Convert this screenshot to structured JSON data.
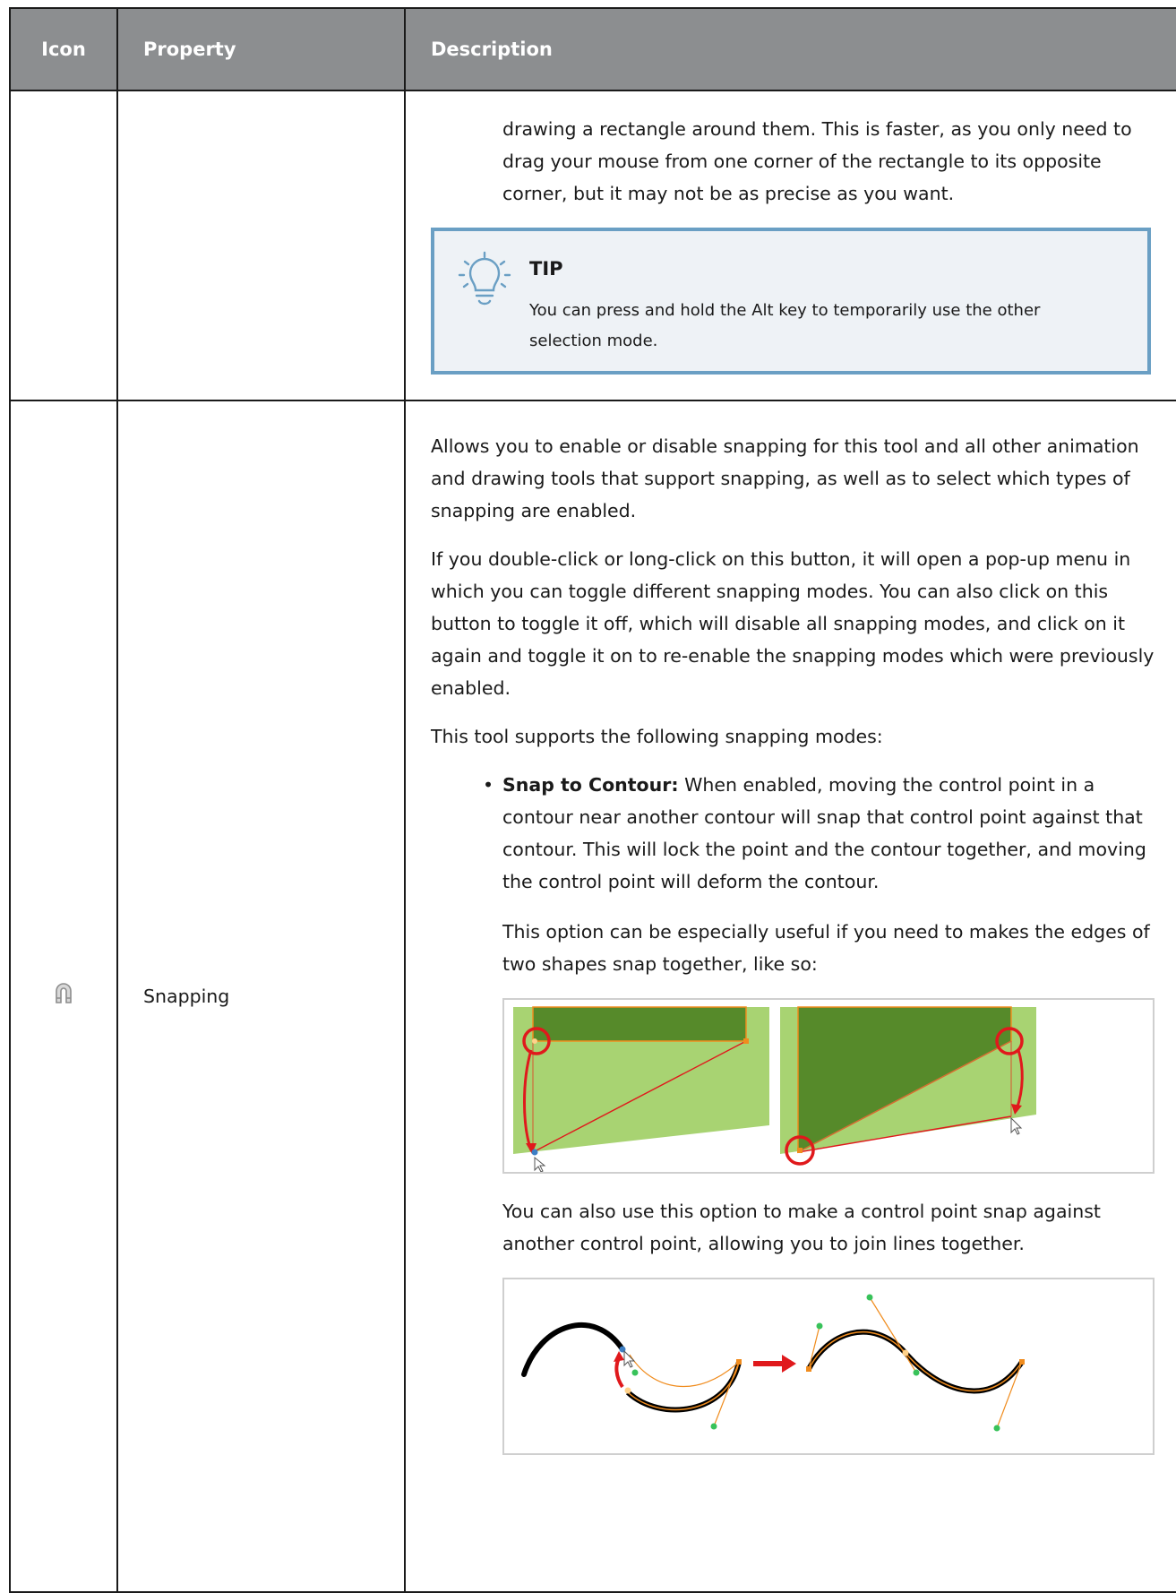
{
  "table": {
    "headers": {
      "icon": "Icon",
      "property": "Property",
      "description": "Description"
    },
    "continued_row": {
      "description_text": "drawing a rectangle around them. This is faster, as you only need to drag your mouse from one corner of the rectangle to its opposite corner, but it may not be as precise as you want.",
      "tip": {
        "icon": "lightbulb-icon",
        "title": "TIP",
        "text": "You can press and hold the Alt key to temporarily use the other selection mode."
      }
    },
    "snapping_row": {
      "icon": "magnet-icon",
      "property": "Snapping",
      "paragraphs": [
        "Allows you to enable or disable snapping for this tool and all other animation and drawing tools that support snapping, as well as to select which types of snapping are enabled.",
        "If you double-click or long-click on this button, it will open a pop-up menu in which you can toggle different snapping modes. You can also click on this button to toggle it off, which will disable all snapping modes, and click on it again and toggle it on to re-enable the snapping modes which were previously enabled.",
        "This tool supports the following snapping modes:"
      ],
      "modes": [
        {
          "bullet": "•",
          "name": "Snap to Contour:",
          "text": " When enabled, moving the control point in a contour near another contour will snap that control point against that contour. This will lock the point and the contour together, and moving the control point will deform the contour."
        }
      ],
      "mode_detail_1": "This option can be especially useful if you need to makes the edges of two shapes snap together, like so:",
      "mode_detail_2": "You can also use this option to make a control point snap against another control point, allowing you to join lines together."
    }
  },
  "colors": {
    "header_bg": "#8c8e90",
    "tip_border": "#6a9fc4",
    "tip_bg": "#eef2f6",
    "shape_light_green": "#a8d372",
    "shape_dark_green": "#568a2a",
    "highlight_red": "#e0191c",
    "point_orange": "#f08c1e",
    "point_green": "#38c25a"
  }
}
